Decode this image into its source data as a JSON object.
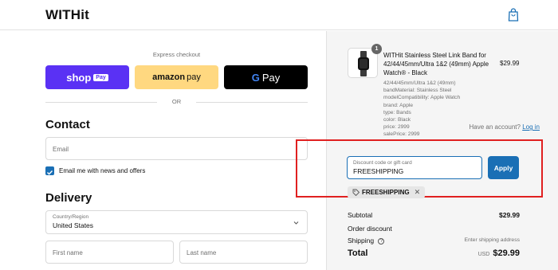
{
  "header": {
    "logo": "WITHit",
    "cart_icon": "shopping-bag-icon"
  },
  "express": {
    "title": "Express checkout",
    "shop_pay": {
      "label": "shop",
      "badge": "Pay"
    },
    "amazon_pay": {
      "label": "amazon",
      "suffix": "pay"
    },
    "google_pay": {
      "g": "G",
      "label": "Pay"
    },
    "or_text": "OR"
  },
  "contact": {
    "title": "Contact",
    "account_prompt": "Have an account?",
    "login_link": "Log in",
    "email_placeholder": "Email",
    "news_opt_in": "Email me with news and offers",
    "news_checked": true
  },
  "delivery": {
    "title": "Delivery",
    "country_label": "Country/Region",
    "country_value": "United States",
    "first_name_placeholder": "First name",
    "last_name_placeholder": "Last name"
  },
  "order": {
    "quantity": "1",
    "product_name": "WITHit Stainless Steel Link Band for 42/44/45mm/Ultra 1&2 (49mm) Apple Watch® - Black",
    "product_price": "$29.99",
    "details": [
      "42/44/45mm/Ultra 1&2 (49mm)",
      "bandMaterial: Stainless Steel",
      "modelCompatibility: Apple Watch",
      "brand: Apple",
      "type: Bands",
      "color: Black",
      "price: 2999",
      "salePrice: 2999"
    ],
    "discount_label": "Discount code or gift card",
    "discount_value": "FREESHIPPING",
    "apply_label": "Apply",
    "applied_code": "FREESHIPPING"
  },
  "summary": {
    "subtotal_label": "Subtotal",
    "subtotal_value": "$29.99",
    "discount_label": "Order discount",
    "shipping_label": "Shipping",
    "shipping_value": "Enter shipping address",
    "total_label": "Total",
    "total_currency": "USD",
    "total_value": "$29.99"
  },
  "colors": {
    "accent": "#1a6fb5",
    "shop_pay": "#5a31f4",
    "amazon_pay": "#ffd880",
    "highlight": "#e02020"
  }
}
